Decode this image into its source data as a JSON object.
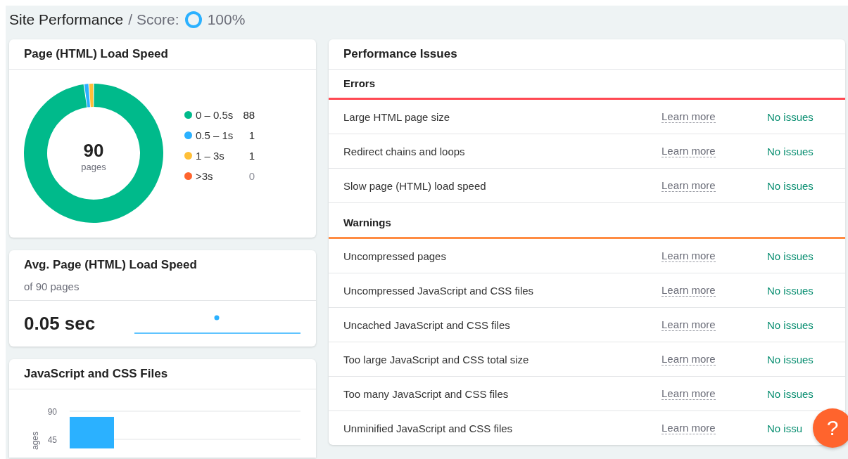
{
  "header": {
    "title": "Site Performance",
    "score_label": "/ Score:",
    "score": {
      "text": "100%"
    }
  },
  "load_speed": {
    "title": "Page (HTML) Load Speed",
    "total": "90",
    "total_label": "pages",
    "chart_data": {
      "type": "donut",
      "categories": [
        "0 – 0.5s",
        "0.5 – 1s",
        "1 – 3s",
        ">3s"
      ],
      "values": [
        88,
        1,
        1,
        0
      ],
      "colors": [
        "#00ba8b",
        "#2bb1ff",
        "#ffbf38",
        "#ff642d"
      ],
      "value_labels": [
        "88",
        "1",
        "1",
        "0"
      ]
    }
  },
  "avg_speed": {
    "title": "Avg. Page (HTML) Load Speed",
    "subtitle": "of 90 pages",
    "value": "0.05 sec"
  },
  "files": {
    "title": "JavaScript and CSS Files",
    "axis": {
      "label": "ages",
      "ticks": [
        "90",
        "45"
      ]
    }
  },
  "issues": {
    "title": "Performance Issues",
    "sections": [
      {
        "title": "Errors",
        "color": "#ff4953",
        "items": [
          {
            "name": "Large HTML page size",
            "link": "Learn more",
            "status": "No issues"
          },
          {
            "name": "Redirect chains and loops",
            "link": "Learn more",
            "status": "No issues"
          },
          {
            "name": "Slow page (HTML) load speed",
            "link": "Learn more",
            "status": "No issues"
          }
        ]
      },
      {
        "title": "Warnings",
        "color": "#ff8c43",
        "items": [
          {
            "name": "Uncompressed pages",
            "link": "Learn more",
            "status": "No issues"
          },
          {
            "name": "Uncompressed JavaScript and CSS files",
            "link": "Learn more",
            "status": "No issues"
          },
          {
            "name": "Uncached JavaScript and CSS files",
            "link": "Learn more",
            "status": "No issues"
          },
          {
            "name": "Too large JavaScript and CSS total size",
            "link": "Learn more",
            "status": "No issues"
          },
          {
            "name": "Too many JavaScript and CSS files",
            "link": "Learn more",
            "status": "No issues"
          },
          {
            "name": "Unminified JavaScript and CSS files",
            "link": "Learn more",
            "status": "No issu"
          }
        ]
      }
    ]
  },
  "help": {
    "label": "?"
  }
}
